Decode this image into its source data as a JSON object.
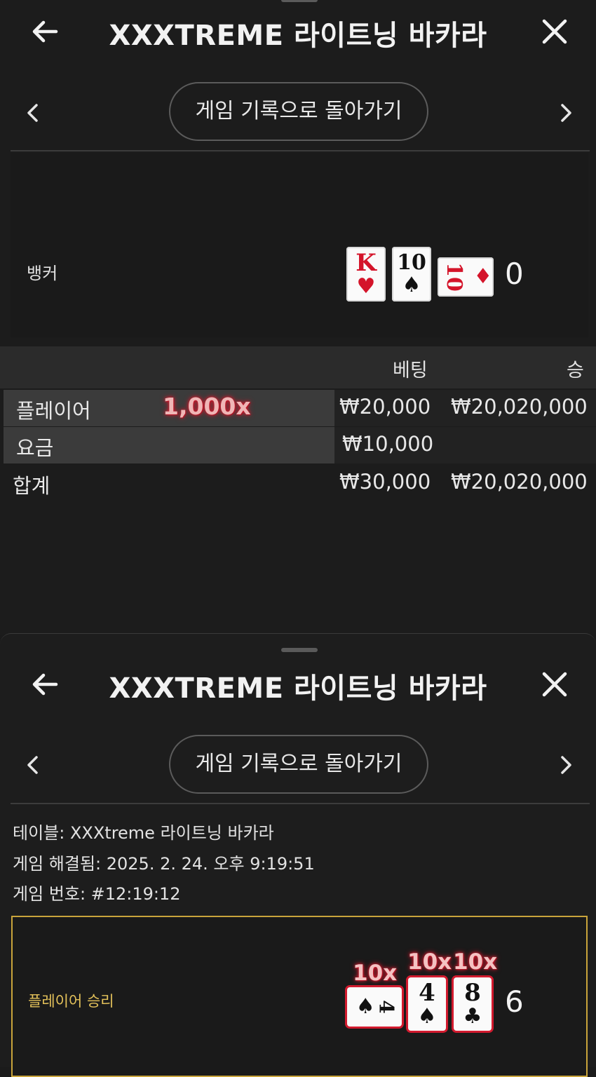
{
  "panel_top": {
    "title": "XXXTREME 라이트닝 바카라",
    "back_icon": "arrow-left-icon",
    "close_icon": "close-icon",
    "nav_button": "게임 기록으로 돌아가기",
    "banker": {
      "label": "뱅커",
      "cards": [
        {
          "rank": "K",
          "suit": "♥",
          "color": "red"
        },
        {
          "rank": "10",
          "suit": "♠",
          "color": "black"
        },
        {
          "rank": "10",
          "suit": "♦",
          "color": "red",
          "rotated": true
        }
      ],
      "score": "0"
    },
    "table": {
      "headers": {
        "bet": "베팅",
        "win": "승"
      },
      "rows": [
        {
          "label": "플레이어",
          "multiplier": "1,000x",
          "bet": "₩20,000",
          "win": "₩20,020,000"
        },
        {
          "label": "요금",
          "bet": "₩10,000",
          "win": ""
        }
      ],
      "total": {
        "label": "합계",
        "bet": "₩30,000",
        "win": "₩20,020,000"
      }
    }
  },
  "panel_bottom": {
    "title": "XXXTREME 라이트닝 바카라",
    "nav_button": "게임 기록으로 돌아가기",
    "info": {
      "table": "테이블: XXXtreme 라이트닝 바카라",
      "resolved": "게임 해결됨: 2025. 2. 24. 오후 9:19:51",
      "game_no": "게임 번호: #12:19:12"
    },
    "player": {
      "label": "플레이어 승리",
      "cards": [
        {
          "rank": "4",
          "suit": "♠",
          "color": "black",
          "rotated": true,
          "multiplier": "10x"
        },
        {
          "rank": "4",
          "suit": "♠",
          "color": "black",
          "multiplier": "10x"
        },
        {
          "rank": "8",
          "suit": "♣",
          "color": "black",
          "multiplier": "10x"
        }
      ],
      "score": "6"
    }
  },
  "colors": {
    "accent_gold": "#c9a43b",
    "lightning_red": "#d21a2e",
    "background": "#1b1b1b"
  }
}
